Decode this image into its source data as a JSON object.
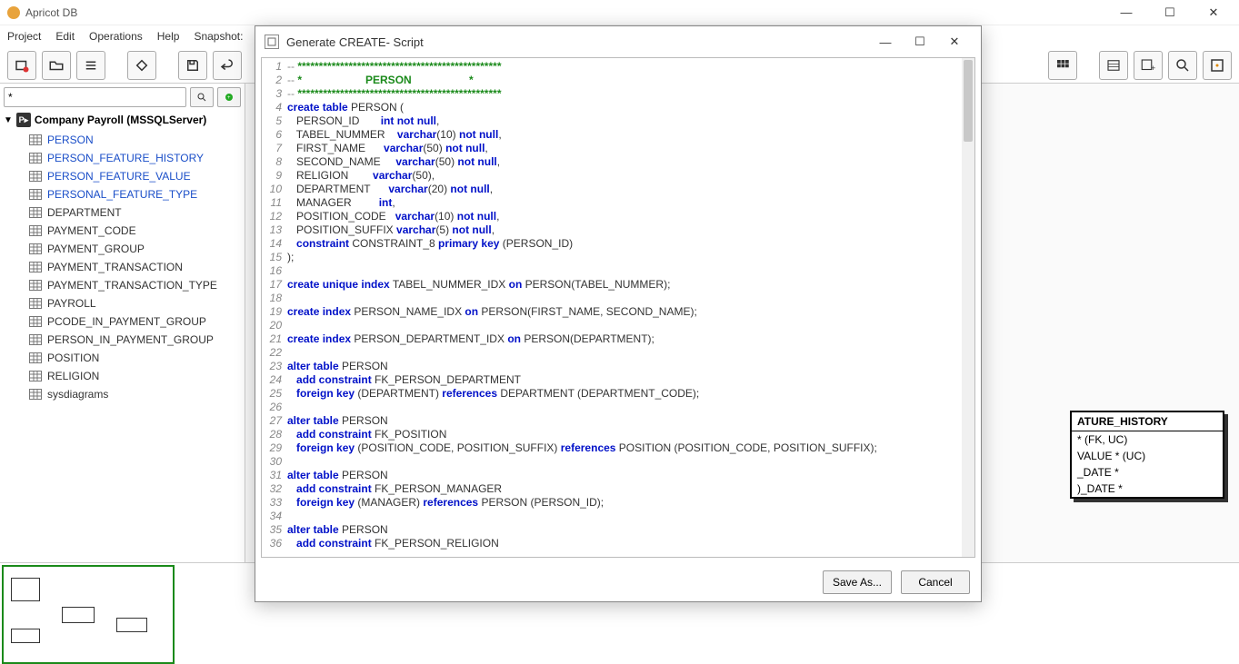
{
  "app": {
    "title": "Apricot DB"
  },
  "menubar": {
    "items": [
      "Project",
      "Edit",
      "Operations",
      "Help",
      "Snapshot:"
    ]
  },
  "sidebar": {
    "search_value": "*",
    "project_label": "Company Payroll (MSSQLServer)",
    "tables_blue": [
      "PERSON",
      "PERSON_FEATURE_HISTORY",
      "PERSON_FEATURE_VALUE",
      "PERSONAL_FEATURE_TYPE"
    ],
    "tables_plain": [
      "DEPARTMENT",
      "PAYMENT_CODE",
      "PAYMENT_GROUP",
      "PAYMENT_TRANSACTION",
      "PAYMENT_TRANSACTION_TYPE",
      "PAYROLL",
      "PCODE_IN_PAYMENT_GROUP",
      "PERSON_IN_PAYMENT_GROUP",
      "POSITION",
      "RELIGION",
      "sysdiagrams"
    ]
  },
  "entity": {
    "title_suffix": "ATURE_HISTORY",
    "rows": [
      "* (FK, UC)",
      "VALUE * (UC)",
      "_DATE *",
      ")_DATE *"
    ]
  },
  "dialog": {
    "title": "Generate CREATE- Script",
    "save_label": "Save As...",
    "cancel_label": "Cancel",
    "code": [
      {
        "n": 1,
        "seg": [
          {
            "c": "tok-c",
            "t": "-- "
          },
          {
            "c": "tok-cg",
            "t": "************************************************"
          }
        ]
      },
      {
        "n": 2,
        "seg": [
          {
            "c": "tok-c",
            "t": "-- "
          },
          {
            "c": "tok-cg",
            "t": "*                     PERSON                   *"
          }
        ]
      },
      {
        "n": 3,
        "seg": [
          {
            "c": "tok-c",
            "t": "-- "
          },
          {
            "c": "tok-cg",
            "t": "************************************************"
          }
        ]
      },
      {
        "n": 4,
        "seg": [
          {
            "c": "tok-k",
            "t": "create table"
          },
          {
            "c": "tok-n",
            "t": " PERSON ("
          }
        ]
      },
      {
        "n": 5,
        "seg": [
          {
            "c": "tok-n",
            "t": "   PERSON_ID       "
          },
          {
            "c": "tok-k",
            "t": "int not null"
          },
          {
            "c": "tok-n",
            "t": ","
          }
        ]
      },
      {
        "n": 6,
        "seg": [
          {
            "c": "tok-n",
            "t": "   TABEL_NUMMER    "
          },
          {
            "c": "tok-k",
            "t": "varchar"
          },
          {
            "c": "tok-n",
            "t": "(10) "
          },
          {
            "c": "tok-k",
            "t": "not null"
          },
          {
            "c": "tok-n",
            "t": ","
          }
        ]
      },
      {
        "n": 7,
        "seg": [
          {
            "c": "tok-n",
            "t": "   FIRST_NAME      "
          },
          {
            "c": "tok-k",
            "t": "varchar"
          },
          {
            "c": "tok-n",
            "t": "(50) "
          },
          {
            "c": "tok-k",
            "t": "not null"
          },
          {
            "c": "tok-n",
            "t": ","
          }
        ]
      },
      {
        "n": 8,
        "seg": [
          {
            "c": "tok-n",
            "t": "   SECOND_NAME     "
          },
          {
            "c": "tok-k",
            "t": "varchar"
          },
          {
            "c": "tok-n",
            "t": "(50) "
          },
          {
            "c": "tok-k",
            "t": "not null"
          },
          {
            "c": "tok-n",
            "t": ","
          }
        ]
      },
      {
        "n": 9,
        "seg": [
          {
            "c": "tok-n",
            "t": "   RELIGION        "
          },
          {
            "c": "tok-k",
            "t": "varchar"
          },
          {
            "c": "tok-n",
            "t": "(50),"
          }
        ]
      },
      {
        "n": 10,
        "seg": [
          {
            "c": "tok-n",
            "t": "   DEPARTMENT      "
          },
          {
            "c": "tok-k",
            "t": "varchar"
          },
          {
            "c": "tok-n",
            "t": "(20) "
          },
          {
            "c": "tok-k",
            "t": "not null"
          },
          {
            "c": "tok-n",
            "t": ","
          }
        ]
      },
      {
        "n": 11,
        "seg": [
          {
            "c": "tok-n",
            "t": "   MANAGER         "
          },
          {
            "c": "tok-k",
            "t": "int"
          },
          {
            "c": "tok-n",
            "t": ","
          }
        ]
      },
      {
        "n": 12,
        "seg": [
          {
            "c": "tok-n",
            "t": "   POSITION_CODE   "
          },
          {
            "c": "tok-k",
            "t": "varchar"
          },
          {
            "c": "tok-n",
            "t": "(10) "
          },
          {
            "c": "tok-k",
            "t": "not null"
          },
          {
            "c": "tok-n",
            "t": ","
          }
        ]
      },
      {
        "n": 13,
        "seg": [
          {
            "c": "tok-n",
            "t": "   POSITION_SUFFIX "
          },
          {
            "c": "tok-k",
            "t": "varchar"
          },
          {
            "c": "tok-n",
            "t": "(5) "
          },
          {
            "c": "tok-k",
            "t": "not null"
          },
          {
            "c": "tok-n",
            "t": ","
          }
        ]
      },
      {
        "n": 14,
        "seg": [
          {
            "c": "tok-n",
            "t": "   "
          },
          {
            "c": "tok-k",
            "t": "constraint"
          },
          {
            "c": "tok-n",
            "t": " CONSTRAINT_8 "
          },
          {
            "c": "tok-k",
            "t": "primary key"
          },
          {
            "c": "tok-n",
            "t": " (PERSON_ID)"
          }
        ]
      },
      {
        "n": 15,
        "seg": [
          {
            "c": "tok-n",
            "t": ");"
          }
        ]
      },
      {
        "n": 16,
        "seg": [
          {
            "c": "tok-n",
            "t": ""
          }
        ]
      },
      {
        "n": 17,
        "seg": [
          {
            "c": "tok-k",
            "t": "create unique index"
          },
          {
            "c": "tok-n",
            "t": " TABEL_NUMMER_IDX "
          },
          {
            "c": "tok-k",
            "t": "on"
          },
          {
            "c": "tok-n",
            "t": " PERSON(TABEL_NUMMER);"
          }
        ]
      },
      {
        "n": 18,
        "seg": [
          {
            "c": "tok-n",
            "t": ""
          }
        ]
      },
      {
        "n": 19,
        "seg": [
          {
            "c": "tok-k",
            "t": "create index"
          },
          {
            "c": "tok-n",
            "t": " PERSON_NAME_IDX "
          },
          {
            "c": "tok-k",
            "t": "on"
          },
          {
            "c": "tok-n",
            "t": " PERSON(FIRST_NAME, SECOND_NAME);"
          }
        ]
      },
      {
        "n": 20,
        "seg": [
          {
            "c": "tok-n",
            "t": ""
          }
        ]
      },
      {
        "n": 21,
        "seg": [
          {
            "c": "tok-k",
            "t": "create index"
          },
          {
            "c": "tok-n",
            "t": " PERSON_DEPARTMENT_IDX "
          },
          {
            "c": "tok-k",
            "t": "on"
          },
          {
            "c": "tok-n",
            "t": " PERSON(DEPARTMENT);"
          }
        ]
      },
      {
        "n": 22,
        "seg": [
          {
            "c": "tok-n",
            "t": ""
          }
        ]
      },
      {
        "n": 23,
        "seg": [
          {
            "c": "tok-k",
            "t": "alter table"
          },
          {
            "c": "tok-n",
            "t": " PERSON"
          }
        ]
      },
      {
        "n": 24,
        "seg": [
          {
            "c": "tok-n",
            "t": "   "
          },
          {
            "c": "tok-k",
            "t": "add constraint"
          },
          {
            "c": "tok-n",
            "t": " FK_PERSON_DEPARTMENT"
          }
        ]
      },
      {
        "n": 25,
        "seg": [
          {
            "c": "tok-n",
            "t": "   "
          },
          {
            "c": "tok-k",
            "t": "foreign key"
          },
          {
            "c": "tok-n",
            "t": " (DEPARTMENT) "
          },
          {
            "c": "tok-k",
            "t": "references"
          },
          {
            "c": "tok-n",
            "t": " DEPARTMENT (DEPARTMENT_CODE);"
          }
        ]
      },
      {
        "n": 26,
        "seg": [
          {
            "c": "tok-n",
            "t": ""
          }
        ]
      },
      {
        "n": 27,
        "seg": [
          {
            "c": "tok-k",
            "t": "alter table"
          },
          {
            "c": "tok-n",
            "t": " PERSON"
          }
        ]
      },
      {
        "n": 28,
        "seg": [
          {
            "c": "tok-n",
            "t": "   "
          },
          {
            "c": "tok-k",
            "t": "add constraint"
          },
          {
            "c": "tok-n",
            "t": " FK_POSITION"
          }
        ]
      },
      {
        "n": 29,
        "seg": [
          {
            "c": "tok-n",
            "t": "   "
          },
          {
            "c": "tok-k",
            "t": "foreign key"
          },
          {
            "c": "tok-n",
            "t": " (POSITION_CODE, POSITION_SUFFIX) "
          },
          {
            "c": "tok-k",
            "t": "references"
          },
          {
            "c": "tok-n",
            "t": " POSITION (POSITION_CODE, POSITION_SUFFIX);"
          }
        ]
      },
      {
        "n": 30,
        "seg": [
          {
            "c": "tok-n",
            "t": ""
          }
        ]
      },
      {
        "n": 31,
        "seg": [
          {
            "c": "tok-k",
            "t": "alter table"
          },
          {
            "c": "tok-n",
            "t": " PERSON"
          }
        ]
      },
      {
        "n": 32,
        "seg": [
          {
            "c": "tok-n",
            "t": "   "
          },
          {
            "c": "tok-k",
            "t": "add constraint"
          },
          {
            "c": "tok-n",
            "t": " FK_PERSON_MANAGER"
          }
        ]
      },
      {
        "n": 33,
        "seg": [
          {
            "c": "tok-n",
            "t": "   "
          },
          {
            "c": "tok-k",
            "t": "foreign key"
          },
          {
            "c": "tok-n",
            "t": " (MANAGER) "
          },
          {
            "c": "tok-k",
            "t": "references"
          },
          {
            "c": "tok-n",
            "t": " PERSON (PERSON_ID);"
          }
        ]
      },
      {
        "n": 34,
        "seg": [
          {
            "c": "tok-n",
            "t": ""
          }
        ]
      },
      {
        "n": 35,
        "seg": [
          {
            "c": "tok-k",
            "t": "alter table"
          },
          {
            "c": "tok-n",
            "t": " PERSON"
          }
        ]
      },
      {
        "n": 36,
        "seg": [
          {
            "c": "tok-n",
            "t": "   "
          },
          {
            "c": "tok-k",
            "t": "add constraint"
          },
          {
            "c": "tok-n",
            "t": " FK_PERSON_RELIGION"
          }
        ]
      }
    ]
  }
}
